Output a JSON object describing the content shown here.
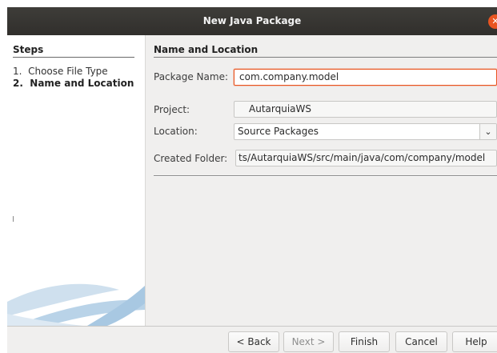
{
  "dialog": {
    "title": "New Java Package"
  },
  "steps": {
    "title": "Steps",
    "items": [
      {
        "number": "1.",
        "label": "Choose File Type"
      },
      {
        "number": "2.",
        "label": "Name and Location"
      }
    ]
  },
  "form": {
    "section_title": "Name and Location",
    "package_name": {
      "label": "Package Name:",
      "value": "com.company.model"
    },
    "project": {
      "label": "Project:",
      "value": "AutarquiaWS"
    },
    "location": {
      "label": "Location:",
      "value": "Source Packages"
    },
    "created_folder": {
      "label": "Created Folder:",
      "value": "ts/AutarquiaWS/src/main/java/com/company/model"
    }
  },
  "buttons": {
    "back": "< Back",
    "next": "Next >",
    "finish": "Finish",
    "cancel": "Cancel",
    "help": "Help"
  },
  "colors": {
    "accent": "#e95420",
    "titlebar": "#3a3935",
    "panel": "#f0efee"
  }
}
